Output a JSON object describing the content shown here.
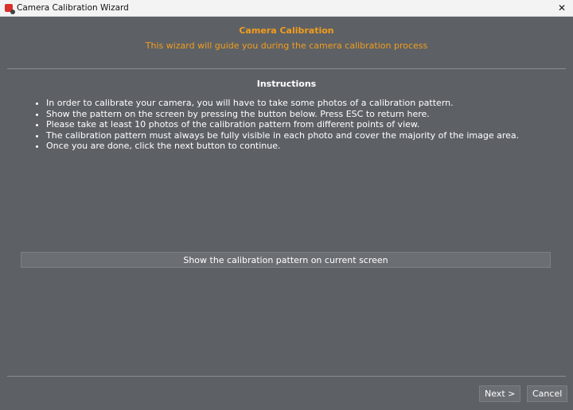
{
  "window": {
    "title": "Camera Calibration Wizard"
  },
  "header": {
    "title": "Camera Calibration",
    "subtitle": "This wizard will guide you during the camera calibration process"
  },
  "instructions": {
    "heading": "Instructions",
    "items": [
      "In order to calibrate your camera, you will have to take some photos of a calibration pattern.",
      "Show the pattern on the screen by pressing the button below. Press ESC to return here.",
      "Please take at least 10 photos of the calibration pattern from different points of view.",
      "The calibration pattern must always be fully visible in each photo and cover the majority of the image area.",
      "Once you are done, click the next button to continue."
    ]
  },
  "buttons": {
    "show_pattern": "Show the calibration pattern on current screen",
    "next": "Next >",
    "cancel": "Cancel"
  }
}
